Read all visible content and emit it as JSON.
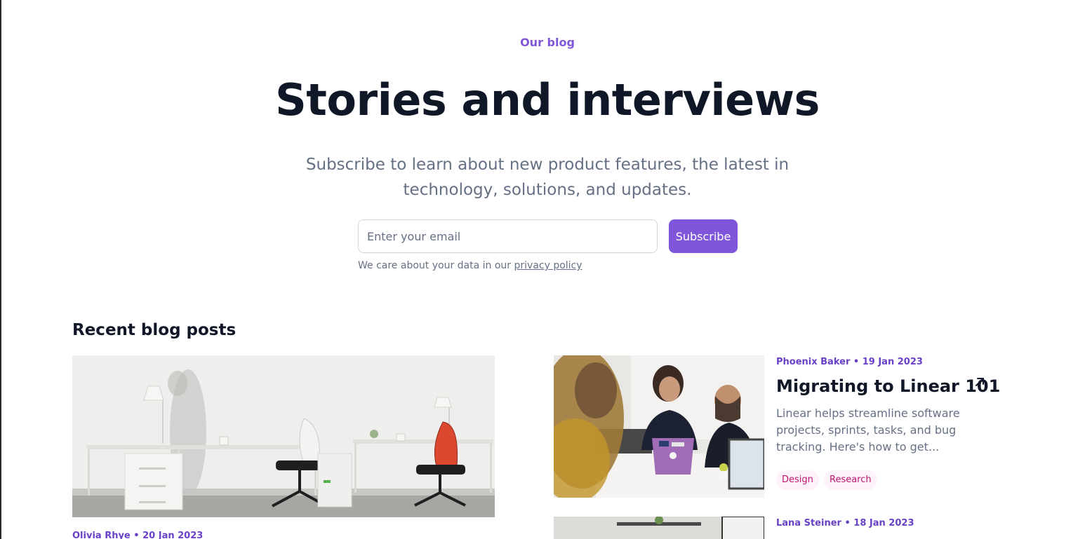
{
  "hero": {
    "eyebrow": "Our blog",
    "headline": "Stories and interviews",
    "subhead": "Subscribe to learn about new product features, the latest in technology, solutions, and updates.",
    "email_placeholder": "Enter your email",
    "subscribe_label": "Subscribe",
    "privacy_prefix": "We care about your data in our ",
    "privacy_link": "privacy policy"
  },
  "recent": {
    "title": "Recent blog posts",
    "featured": {
      "meta": "Olivia Rhye • 20 Jan 2023"
    },
    "posts": [
      {
        "meta": "Phoenix Baker • 19 Jan 2023",
        "title": "Migrating to Linear 101",
        "excerpt": "Linear helps streamline software projects, sprints, tasks, and bug tracking. Here's how to get...",
        "tags": [
          "Design",
          "Research"
        ]
      },
      {
        "meta": "Lana Steiner • 18 Jan 2023"
      }
    ]
  },
  "colors": {
    "accent": "#7f56d9",
    "meta": "#6941c6",
    "heading": "#101828",
    "muted": "#667085",
    "tag_bg": "#fdf2fa",
    "tag_text": "#c11574"
  },
  "icons": {
    "post_link": "arrow-up-right-icon"
  }
}
